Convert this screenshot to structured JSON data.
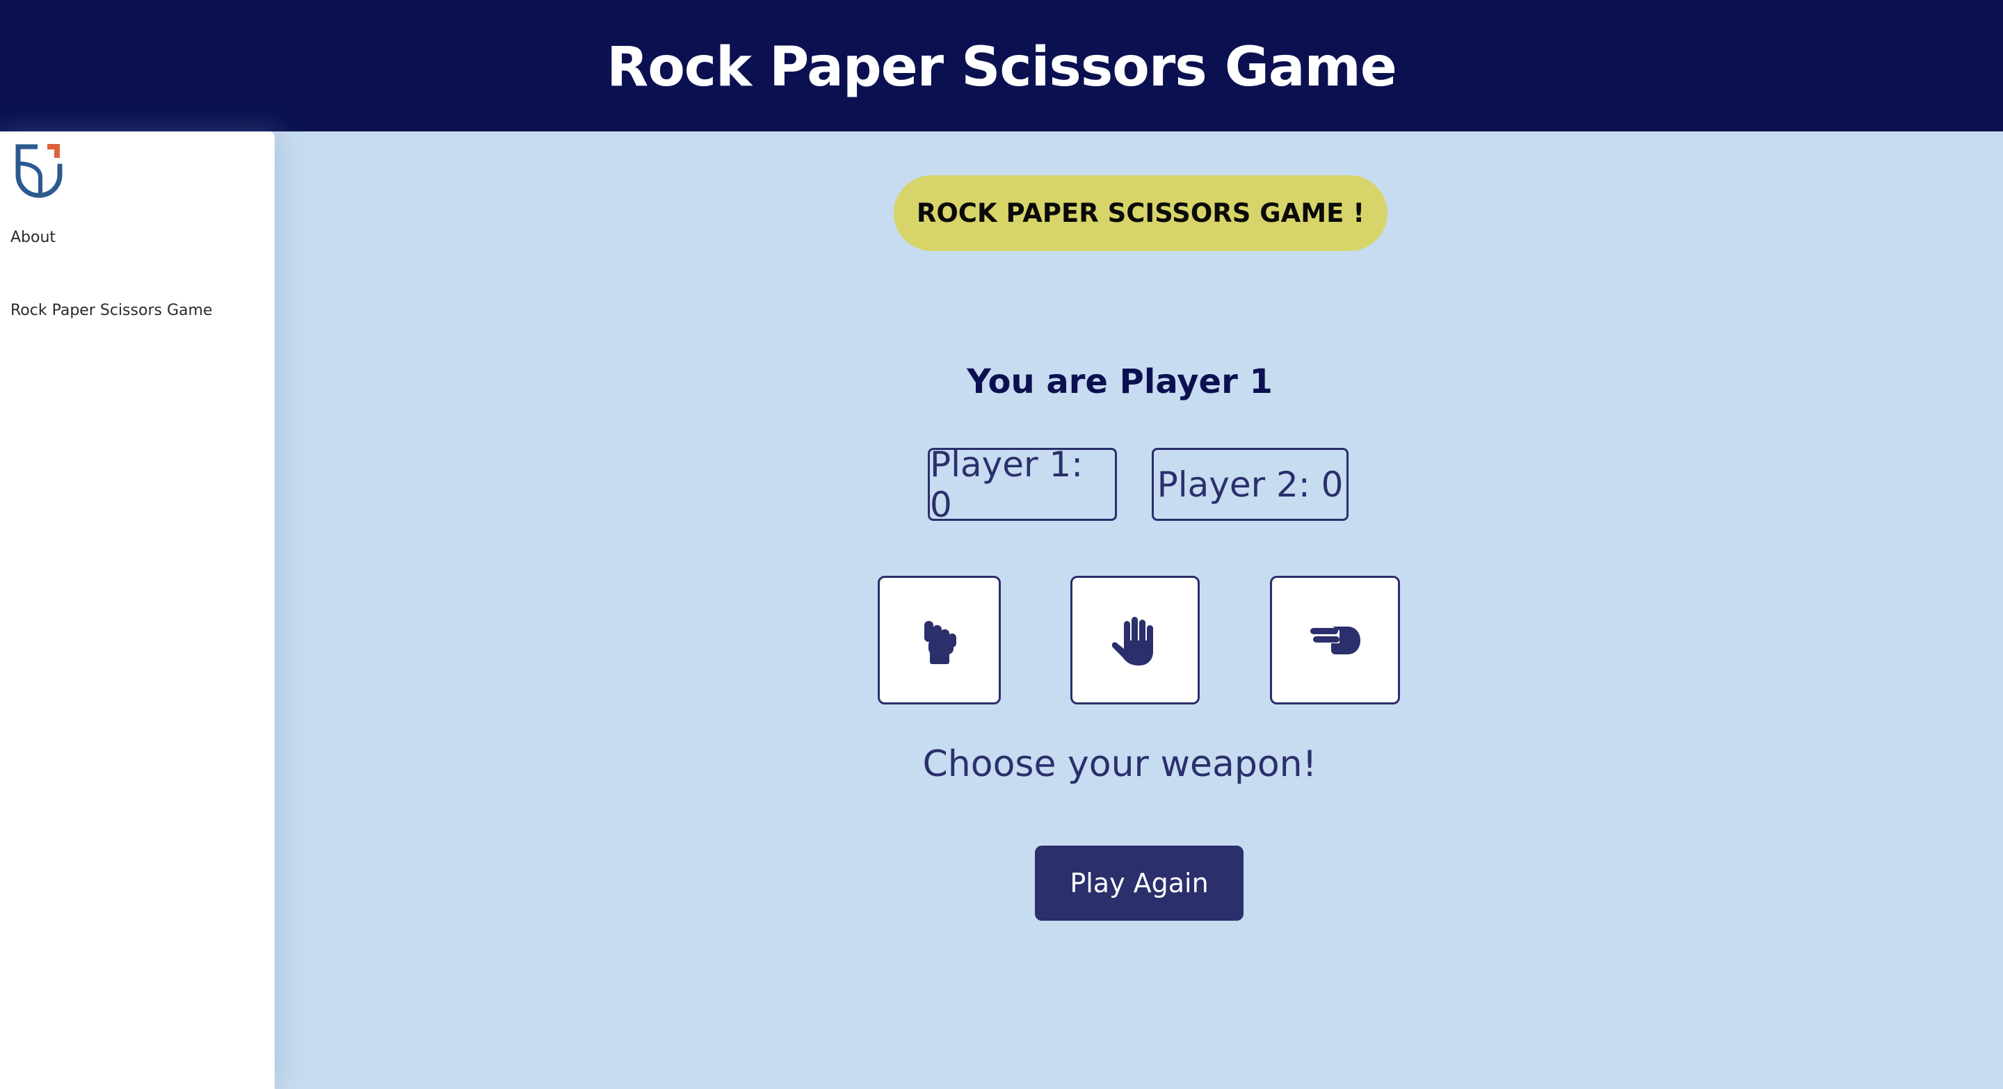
{
  "header": {
    "title": "Rock Paper Scissors Game"
  },
  "sidebar": {
    "logo_icon": "shield-logo-icon",
    "items": [
      {
        "label": "About"
      },
      {
        "label": "Rock Paper Scissors Game"
      }
    ]
  },
  "main": {
    "banner_label": "ROCK PAPER SCISSORS GAME !",
    "player_label": "You are Player 1",
    "scores": {
      "player1": "Player 1: 0",
      "player2": "Player 2: 0"
    },
    "weapons": [
      {
        "icon": "rock-hand-icon"
      },
      {
        "icon": "paper-hand-icon"
      },
      {
        "icon": "scissors-hand-icon"
      }
    ],
    "status_text": "Choose your weapon!",
    "play_again_label": "Play Again"
  },
  "colors": {
    "header_bg": "#0b1150",
    "page_bg": "#c7dcf1",
    "banner_bg": "#d7d56a",
    "accent": "#2b2f6b",
    "logo_blue": "#2c5a8f",
    "logo_orange": "#e0623a"
  }
}
